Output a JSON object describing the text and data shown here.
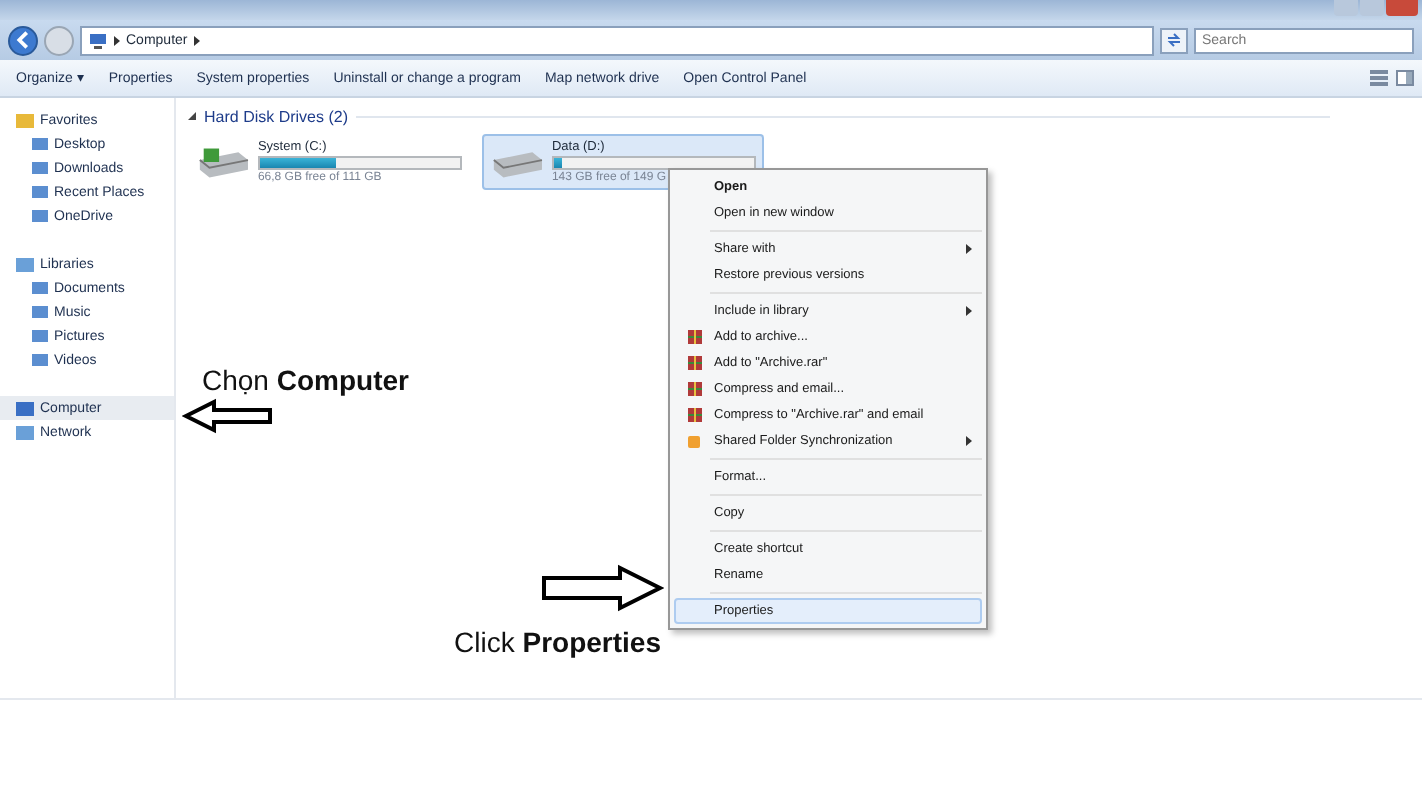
{
  "address_bar": {
    "path": [
      "Computer"
    ],
    "search": {
      "placeholder": "Search"
    }
  },
  "toolbar": [
    "Organize ▾",
    "Properties",
    "System properties",
    "Uninstall or change a program",
    "Map network drive",
    "Open Control Panel"
  ],
  "sidebar": {
    "items": [
      {
        "label": "Favorites",
        "selected": false,
        "children": [
          {
            "label": "Desktop",
            "selected": false
          },
          {
            "label": "Downloads",
            "selected": false
          },
          {
            "label": "Recent Places",
            "selected": false
          },
          {
            "label": "OneDrive",
            "selected": false
          }
        ]
      },
      {
        "label": "Libraries",
        "selected": false,
        "children": [
          {
            "label": "Documents",
            "selected": false
          },
          {
            "label": "Music",
            "selected": false
          },
          {
            "label": "Pictures",
            "selected": false
          },
          {
            "label": "Videos",
            "selected": false
          }
        ]
      },
      {
        "label": "Computer",
        "selected": true
      },
      {
        "label": "Network",
        "selected": false
      }
    ]
  },
  "section": {
    "title": "Hard Disk Drives (2)"
  },
  "drives": [
    {
      "name": "System (C:)",
      "level": 0.38,
      "free": "66,8 GB free of 111 GB",
      "selected": false
    },
    {
      "name": "Data (D:)",
      "level": 0.04,
      "free": "143 GB free of 149 G",
      "selected": true
    }
  ],
  "context_menu": [
    {
      "kind": "item",
      "label": "Open",
      "bold": true,
      "submenu": false,
      "selected": false
    },
    {
      "kind": "item",
      "label": "Open in new window",
      "submenu": false,
      "selected": false
    },
    {
      "kind": "separator"
    },
    {
      "kind": "item",
      "label": "Share with",
      "submenu": true,
      "selected": false
    },
    {
      "kind": "item",
      "label": "Restore previous versions",
      "submenu": false,
      "selected": false
    },
    {
      "kind": "separator"
    },
    {
      "kind": "item",
      "label": "Include in library",
      "submenu": true,
      "selected": false
    },
    {
      "kind": "archive",
      "label": "Add to archive...",
      "submenu": false,
      "selected": false
    },
    {
      "kind": "archive",
      "label": "Add to \"Archive.rar\"",
      "submenu": false,
      "selected": false
    },
    {
      "kind": "archive",
      "label": "Compress and email...",
      "submenu": false,
      "selected": false
    },
    {
      "kind": "archive",
      "label": "Compress to \"Archive.rar\" and email",
      "submenu": false,
      "selected": false
    },
    {
      "kind": "sync",
      "label": "Shared Folder Synchronization",
      "submenu": true,
      "selected": false
    },
    {
      "kind": "separator"
    },
    {
      "kind": "item",
      "label": "Format...",
      "submenu": false,
      "selected": false
    },
    {
      "kind": "separator"
    },
    {
      "kind": "item",
      "label": "Copy",
      "submenu": false,
      "selected": false
    },
    {
      "kind": "separator"
    },
    {
      "kind": "item",
      "label": "Create shortcut",
      "submenu": false,
      "selected": false
    },
    {
      "kind": "item",
      "label": "Rename",
      "submenu": false,
      "selected": false
    },
    {
      "kind": "separator"
    },
    {
      "kind": "item",
      "label": "Properties",
      "submenu": false,
      "selected": true
    }
  ],
  "annotations": [
    {
      "text": "Chọn **Computer**"
    },
    {
      "text": "Click **Properties**"
    }
  ]
}
